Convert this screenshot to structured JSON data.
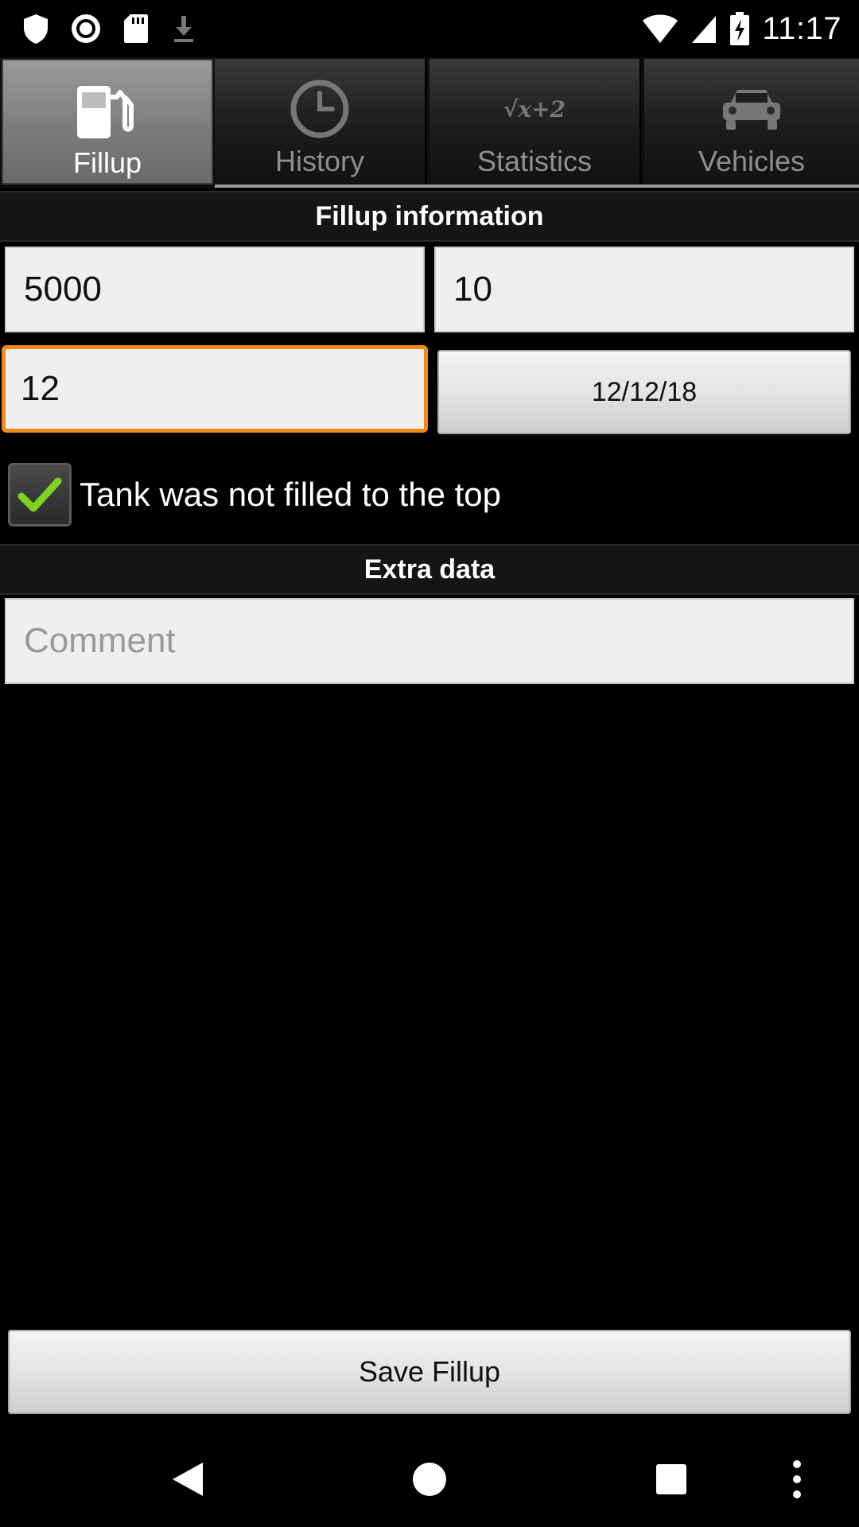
{
  "status_bar": {
    "time": "11:17",
    "left_icons": [
      "shield-icon",
      "record-icon",
      "sd-card-icon",
      "download-icon"
    ],
    "right_icons": [
      "wifi-icon",
      "signal-icon",
      "battery-charging-icon"
    ]
  },
  "tabs": [
    {
      "label": "Fillup",
      "icon": "fuel-pump-icon",
      "active": true
    },
    {
      "label": "History",
      "icon": "clock-icon",
      "active": false
    },
    {
      "label": "Statistics",
      "icon": "formula-icon",
      "active": false,
      "icon_text": "√x+2"
    },
    {
      "label": "Vehicles",
      "icon": "car-icon",
      "active": false
    }
  ],
  "fillup_section": {
    "title": "Fillup information",
    "field1_value": "5000",
    "field2_value": "10",
    "field3_value": "12",
    "date_value": "12/12/18",
    "checkbox_checked": true,
    "checkbox_label": "Tank was not filled to the top"
  },
  "extra_section": {
    "title": "Extra data",
    "comment_placeholder": "Comment"
  },
  "save_button_label": "Save Fillup",
  "colors": {
    "focus_border": "#f08a1c",
    "checkmark": "#7ed321"
  }
}
